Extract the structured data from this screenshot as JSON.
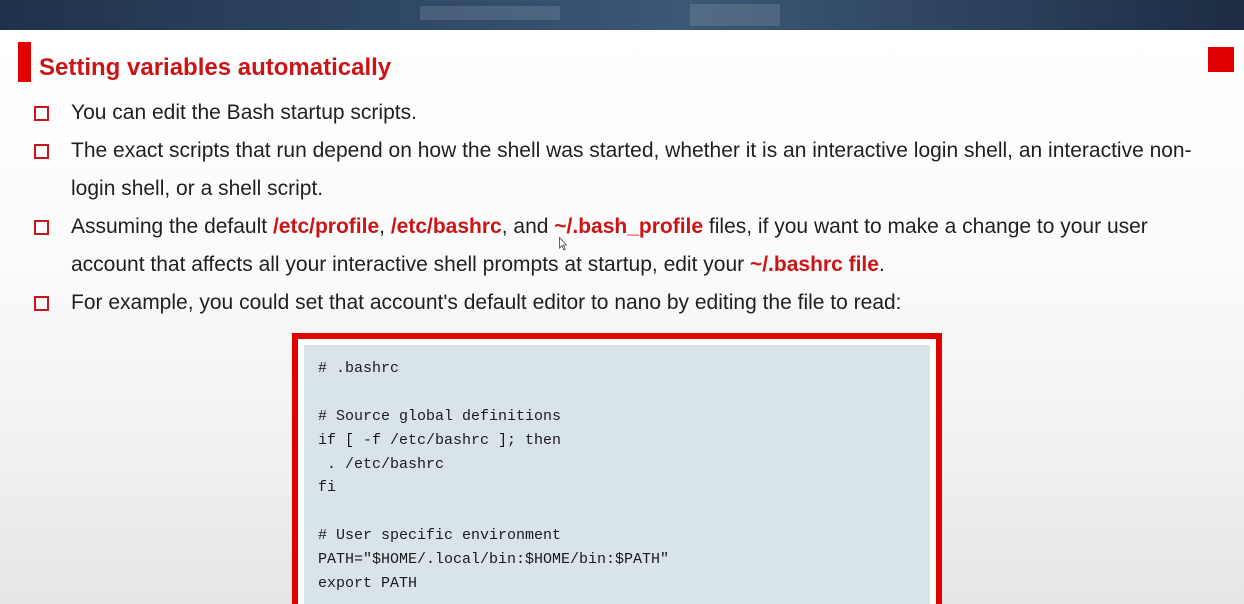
{
  "slide": {
    "title": "Setting variables automatically",
    "bullets": [
      {
        "text": "You can edit the Bash startup scripts."
      },
      {
        "text": "The exact scripts that run depend on how the shell was started, whether it is an interactive login shell, an interactive non-login shell, or a shell script."
      },
      {
        "parts": [
          "Assuming the default ",
          "/etc/profile",
          ", ",
          "/etc/bashrc",
          ", and ",
          "~/.bash_profile",
          " files, if you want to make a change to your user account that affects all your interactive shell prompts at startup, edit your ",
          "~/.bashrc file",
          "."
        ]
      },
      {
        "text": "For example, you could set that account's default editor to nano by editing the file to read:"
      }
    ],
    "code_lines": [
      "# .bashrc",
      "",
      "# Source global definitions",
      "if [ -f /etc/bashrc ]; then",
      " . /etc/bashrc",
      "fi",
      "",
      "# User specific environment",
      "PATH=\"$HOME/.local/bin:$HOME/bin:$PATH\"",
      "export PATH"
    ]
  },
  "colors": {
    "accent_red": "#e00000",
    "title_red": "#cc1416",
    "code_background": "#d9e3ea"
  },
  "icons": {
    "bullet": "square-checkbox-icon",
    "pointer": "mouse-cursor-icon",
    "corner": "red-square-icon"
  }
}
